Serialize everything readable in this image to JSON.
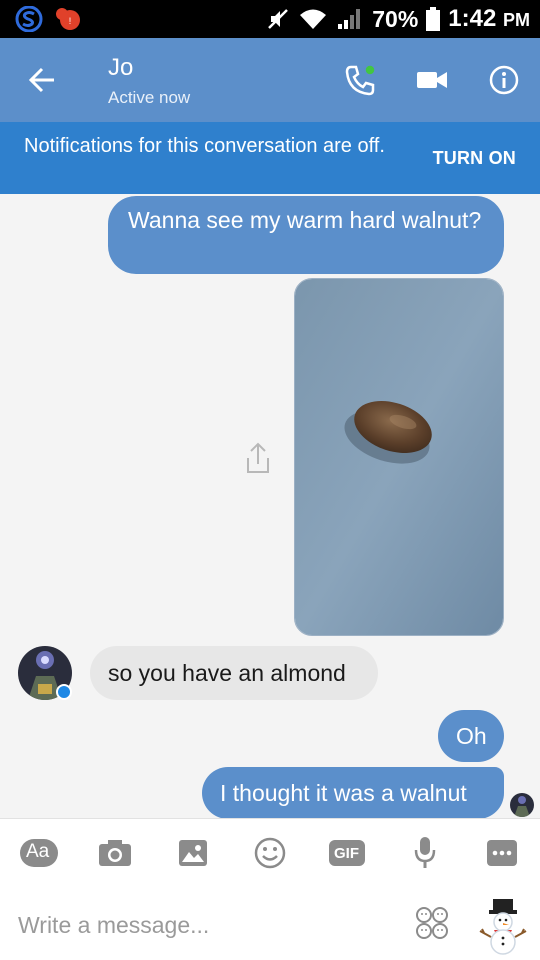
{
  "status_bar": {
    "battery": "70%",
    "time": "1:42",
    "ampm": "PM"
  },
  "header": {
    "name": "Jo",
    "status": "Active now"
  },
  "notification": {
    "text": "Notifications for this conversation are off.",
    "action": "TURN ON"
  },
  "messages": [
    {
      "direction": "outgoing",
      "text": "Wanna see my warm hard walnut?"
    },
    {
      "direction": "outgoing",
      "type": "photo",
      "description": "almond"
    },
    {
      "direction": "incoming",
      "text": "so you have an almond"
    },
    {
      "direction": "outgoing",
      "text": "Oh"
    },
    {
      "direction": "outgoing",
      "text": "I thought it was a walnut"
    }
  ],
  "composer": {
    "aa_label": "Aa",
    "gif_label": "GIF",
    "placeholder": "Write a message..."
  },
  "colors": {
    "header": "#5c8fca",
    "banner": "#2f80cd",
    "outgoing_bubble": "#5b8fcb",
    "incoming_bubble": "#e7e7e7"
  }
}
